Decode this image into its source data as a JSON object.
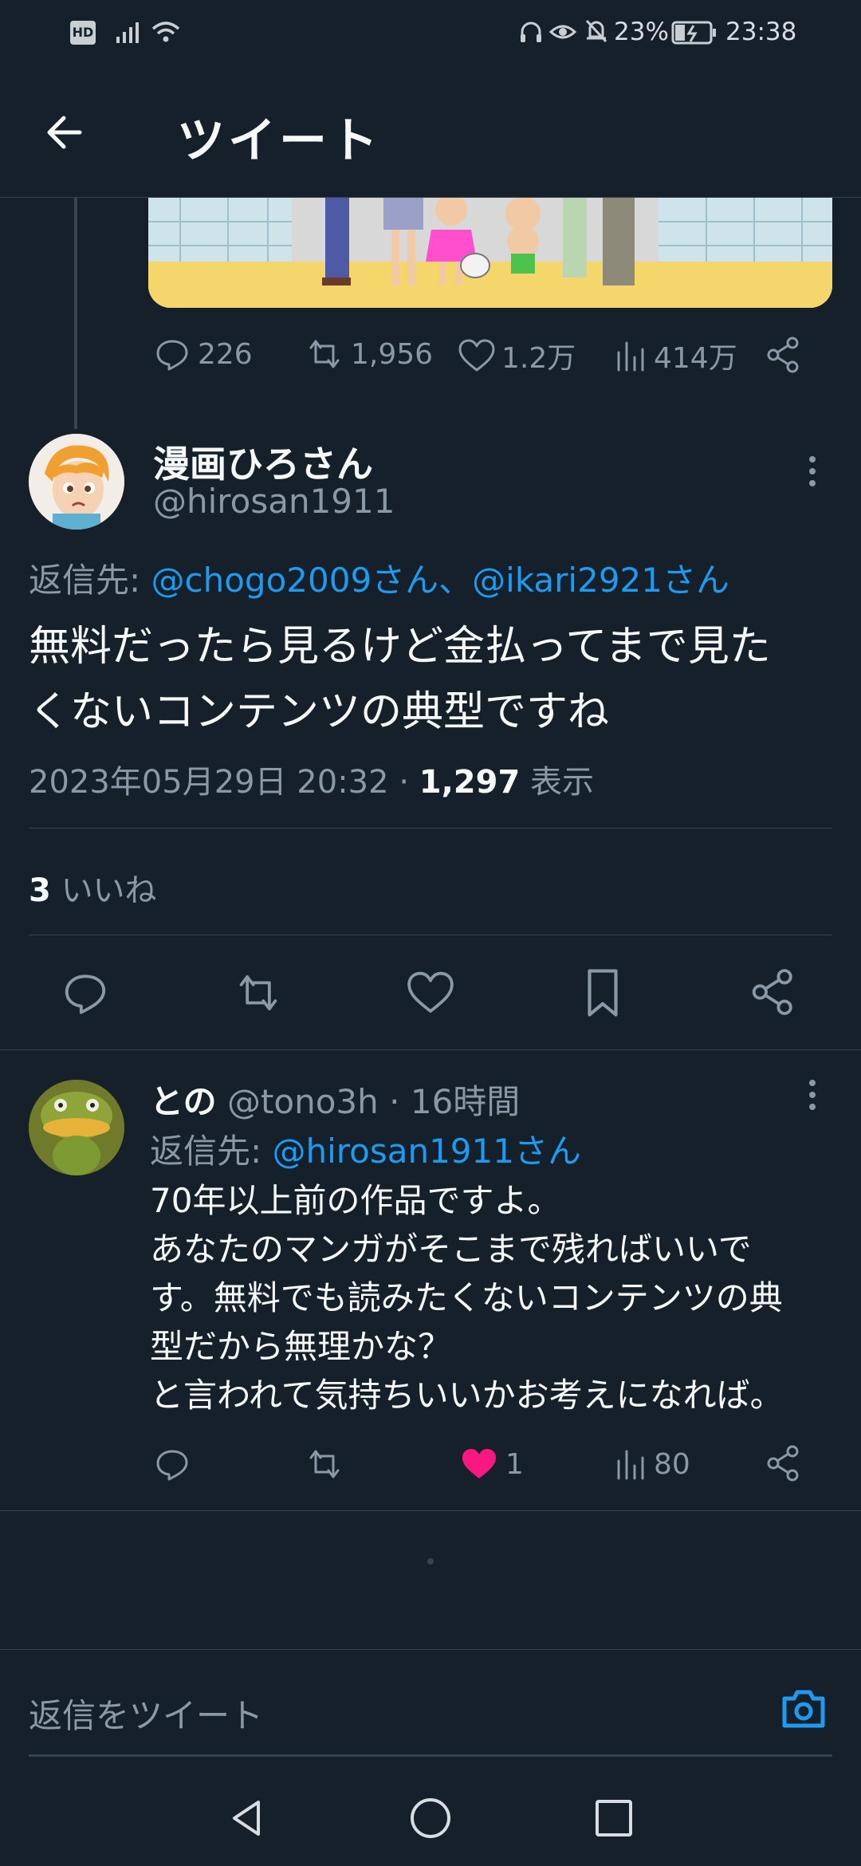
{
  "status_bar": {
    "hd": "HD",
    "battery": "23%",
    "time": "23:38"
  },
  "header": {
    "title": "ツイート"
  },
  "quoted_stats": {
    "replies": "226",
    "retweets": "1,956",
    "likes": "1.2万",
    "views": "414万"
  },
  "main_tweet": {
    "display_name": "漫画ひろさん",
    "handle": "@hirosan1911",
    "reply_to_label": "返信先:",
    "reply_to_users": "@chogo2009さん、@ikari2921さん",
    "text_line1": "無料だったら見るけど金払ってまで見た",
    "text_line2": "くないコンテンツの典型ですね",
    "timestamp": "2023年05月29日 20:32",
    "separator": "·",
    "views_count": "1,297",
    "views_label": "表示",
    "likes_count": "3",
    "likes_label": "いいね"
  },
  "reply": {
    "display_name": "との",
    "handle": "@tono3h",
    "separator": "·",
    "time": "16時間",
    "reply_to_label": "返信先:",
    "reply_to_user": "@hirosan1911さん",
    "lines": [
      "70年以上前の作品ですよ。",
      "あなたのマンガがそこまで残ればいいで",
      "す。無料でも読みたくないコンテンツの典",
      "型だから無理かな？",
      "と言われて気持ちいいかお考えになれば。"
    ],
    "likes": "1",
    "views": "80"
  },
  "compose": {
    "placeholder": "返信をツイート"
  },
  "colors": {
    "background": "#15202b",
    "divider": "#38444d",
    "secondary_text": "#8b98a5",
    "link": "#1d9bf0",
    "like": "#f91880"
  }
}
